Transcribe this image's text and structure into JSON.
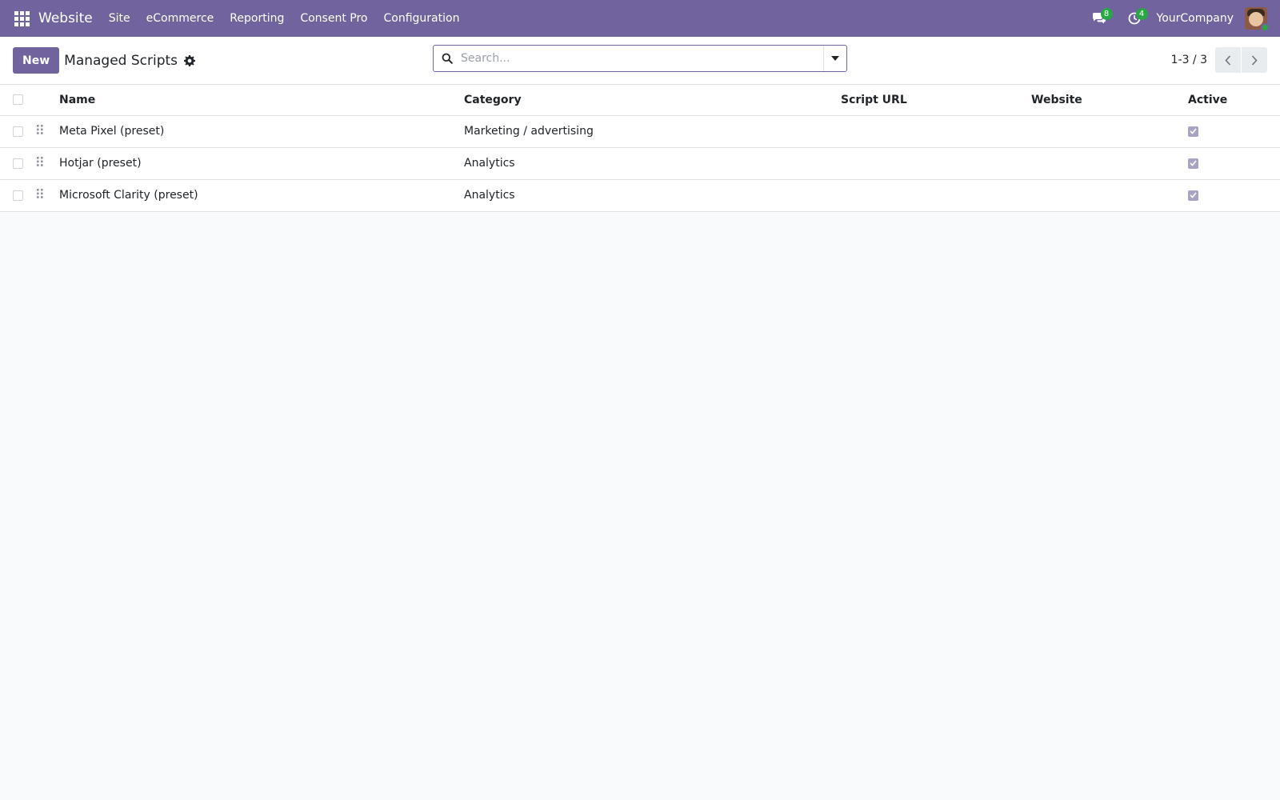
{
  "navbar": {
    "brand": "Website",
    "menu": [
      {
        "label": "Site"
      },
      {
        "label": "eCommerce"
      },
      {
        "label": "Reporting"
      },
      {
        "label": "Consent Pro"
      },
      {
        "label": "Configuration"
      }
    ],
    "messages_count": "8",
    "activities_count": "4",
    "company": "YourCompany"
  },
  "control_panel": {
    "new_label": "New",
    "title": "Managed Scripts",
    "search_placeholder": "Search...",
    "pager_value": "1-3 / 3"
  },
  "table": {
    "columns": [
      "Name",
      "Category",
      "Script URL",
      "Website",
      "Active"
    ],
    "rows": [
      {
        "name": "Meta Pixel (preset)",
        "category": "Marketing / advertising",
        "script_url": "",
        "website": "",
        "active": true
      },
      {
        "name": "Hotjar (preset)",
        "category": "Analytics",
        "script_url": "",
        "website": "",
        "active": true
      },
      {
        "name": "Microsoft Clarity (preset)",
        "category": "Analytics",
        "script_url": "",
        "website": "",
        "active": true
      }
    ]
  },
  "colors": {
    "brand": "#71639e",
    "badge": "#28a745"
  }
}
